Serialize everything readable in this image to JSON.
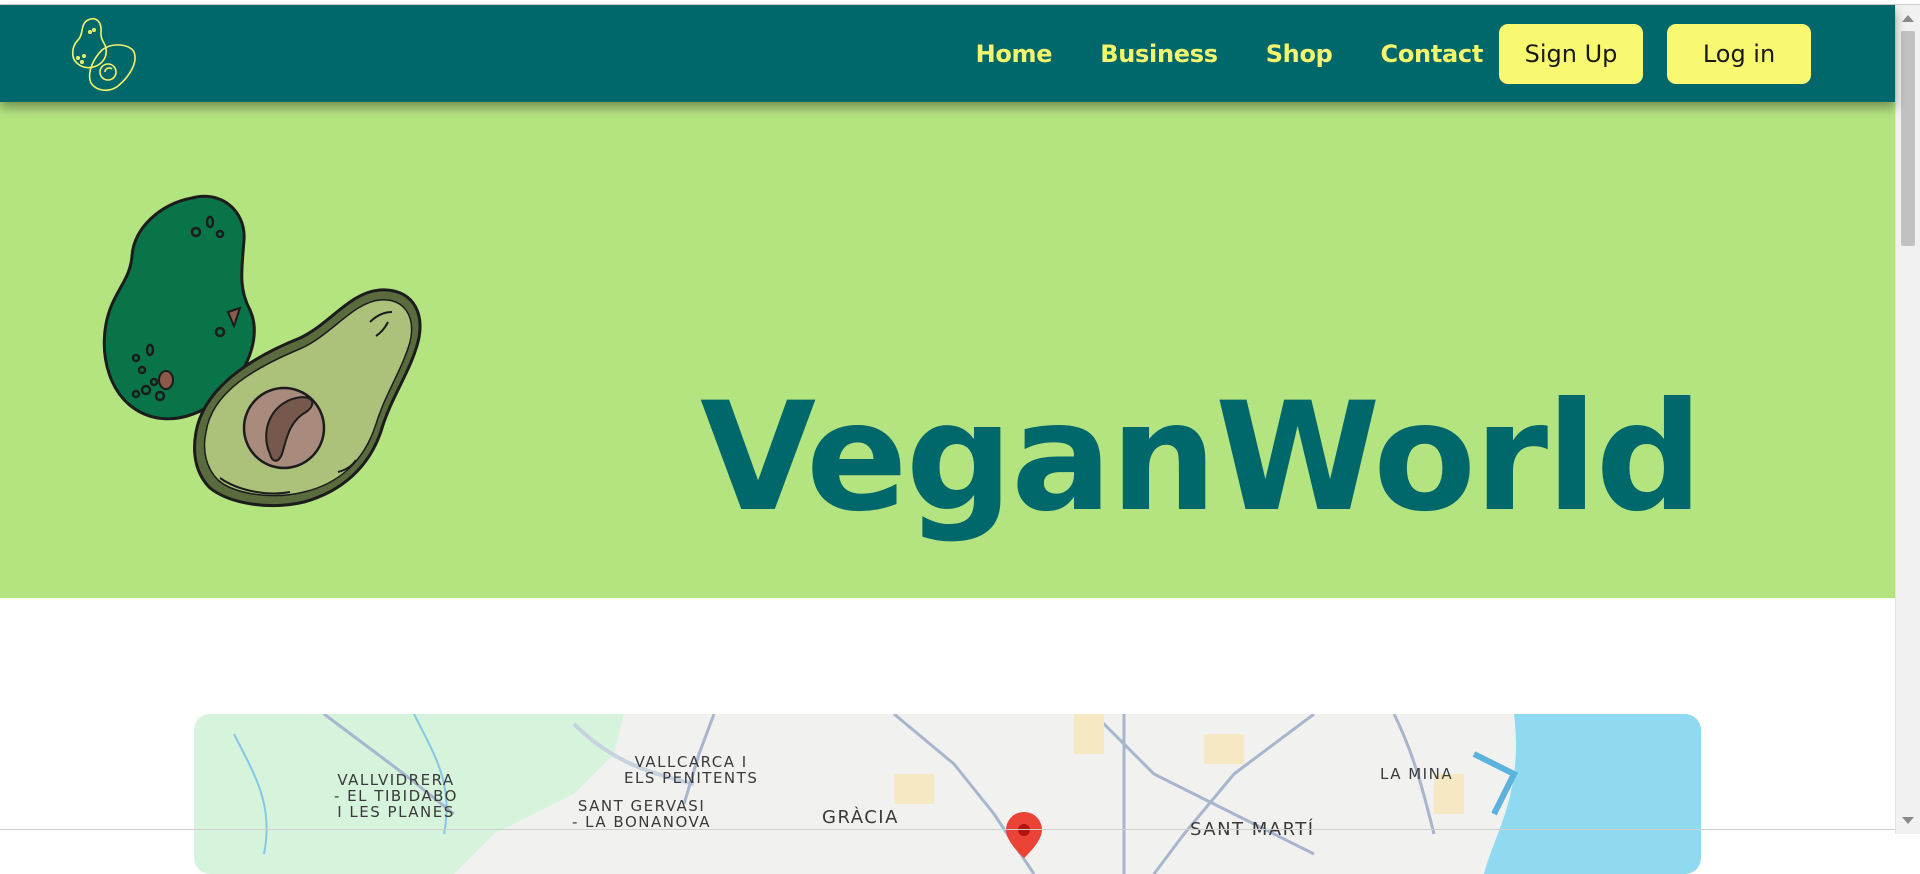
{
  "brand": {
    "name": "VeganWorld",
    "primary_color": "#00686a",
    "accent_color": "#f9f871",
    "hero_background": "#b4e47f"
  },
  "nav": {
    "logo_icon": "avocado-logo-icon",
    "links": [
      "Home",
      "Business",
      "Shop",
      "Contact"
    ],
    "signup_label": "Sign Up",
    "login_label": "Log in"
  },
  "hero": {
    "title": "VeganWorld",
    "illustration_icon": "avocado-illustration"
  },
  "map": {
    "labels": {
      "vallvidrera": [
        "VALLVIDRERA",
        "- EL TIBIDABO",
        "I LES PLANES"
      ],
      "vallcarca": [
        "VALLCARCA I",
        "ELS PENITENTS"
      ],
      "sant_gervasi": [
        "SANT GERVASI",
        "- LA BONANOVA"
      ],
      "gracia": "GRÀCIA",
      "la_mina": "LA MINA",
      "sant_marti": "SANT MARTÍ"
    },
    "marker_icon": "map-pin-icon"
  }
}
